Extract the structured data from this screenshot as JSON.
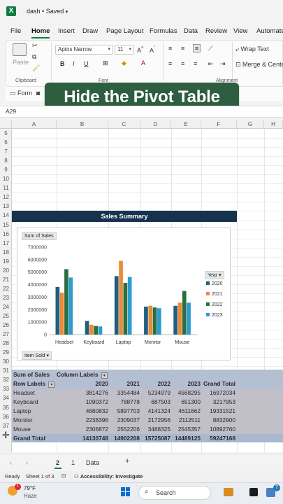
{
  "window": {
    "app_icon_letter": "X",
    "doc_title": "dash",
    "save_status": "Saved"
  },
  "menu": [
    "File",
    "Home",
    "Insert",
    "Draw",
    "Page Layout",
    "Formulas",
    "Data",
    "Review",
    "View",
    "Automate"
  ],
  "ribbon": {
    "paste_label": "Paste",
    "clipboard_label": "Clipboard",
    "font_label": "Font",
    "alignment_label": "Alignment",
    "font_name": "Aptos Narrow",
    "font_size": "11",
    "wrap_text_label": "Wrap Text",
    "merge_label": "Merge & Center",
    "form_label": "Form"
  },
  "banner_text": "Hide the Pivot Table",
  "formula_bar": {
    "name_box": "A29"
  },
  "columns": [
    "A",
    "B",
    "C",
    "D",
    "E",
    "F",
    "G",
    "H"
  ],
  "rows": [
    "5",
    "6",
    "7",
    "8",
    "9",
    "10",
    "11",
    "12",
    "13",
    "14",
    "15",
    "16",
    "17",
    "18",
    "19",
    "20",
    "21",
    "22",
    "23",
    "24",
    "25",
    "26",
    "27",
    "28",
    "29",
    "30",
    "31",
    "32",
    "33",
    "34",
    "35",
    "36",
    "37"
  ],
  "chart_title": "Sales Summary",
  "chart_data": {
    "type": "bar",
    "title": "Sales Summary",
    "field_button_values": "Sum of Sales",
    "field_button_axis": "Item Sold",
    "legend_title": "Year",
    "legend_position": "right",
    "categories": [
      "Headset",
      "Keyboard",
      "Laptop",
      "Monitor",
      "Mouse"
    ],
    "series": [
      {
        "name": "2020",
        "color": "#205e7e",
        "values": [
          3814276,
          1090372,
          4680832,
          2238396,
          2306872
        ]
      },
      {
        "name": "2021",
        "color": "#e98b3a",
        "values": [
          3354484,
          788778,
          5897703,
          2309037,
          2552206
        ]
      },
      {
        "name": "2022",
        "color": "#2d6e3f",
        "values": [
          5234979,
          687503,
          4141324,
          2172956,
          3488325
        ]
      },
      {
        "name": "2023",
        "color": "#2a9dd1",
        "values": [
          4568295,
          651300,
          4611662,
          2112511,
          2545357
        ]
      }
    ],
    "ylim": [
      0,
      7000000
    ],
    "yticks": [
      "0",
      "1000000",
      "2000000",
      "3000000",
      "4000000",
      "5000000",
      "6000000",
      "7000000"
    ],
    "grid": false
  },
  "pivot": {
    "corner": "Sum of Sales",
    "column_labels": "Column Labels",
    "row_labels": "Row Labels",
    "years": [
      "2020",
      "2021",
      "2022",
      "2023"
    ],
    "grand_total_label": "Grand Total",
    "rows": [
      {
        "label": "Headset",
        "values": [
          "3814276",
          "3354484",
          "5234979",
          "4568295"
        ],
        "total": "16972034"
      },
      {
        "label": "Keyboard",
        "values": [
          "1090372",
          "788778",
          "687503",
          "651300"
        ],
        "total": "3217953"
      },
      {
        "label": "Laptop",
        "values": [
          "4680832",
          "5897703",
          "4141324",
          "4611662"
        ],
        "total": "19331521"
      },
      {
        "label": "Monitor",
        "values": [
          "2238396",
          "2309037",
          "2172956",
          "2112511"
        ],
        "total": "8832900"
      },
      {
        "label": "Mouse",
        "values": [
          "2306872",
          "2552206",
          "3488325",
          "2545357"
        ],
        "total": "10892760"
      }
    ],
    "grand_total": {
      "values": [
        "14130748",
        "14902208",
        "15725087",
        "14489125"
      ],
      "total": "59247168"
    }
  },
  "tabs": {
    "prev": "‹",
    "next": "›",
    "sheet_a": "2",
    "sheet_b": "1",
    "sheet_c": "Data",
    "add": "+"
  },
  "status": {
    "ready": "Ready",
    "sheet_info": "Sheet 1 of 3",
    "accessibility": "Accessibility: Investigate"
  },
  "taskbar": {
    "temp": "79°F",
    "weather": "Haze",
    "search_placeholder": "Search",
    "badge": "1",
    "badge2": "7"
  }
}
